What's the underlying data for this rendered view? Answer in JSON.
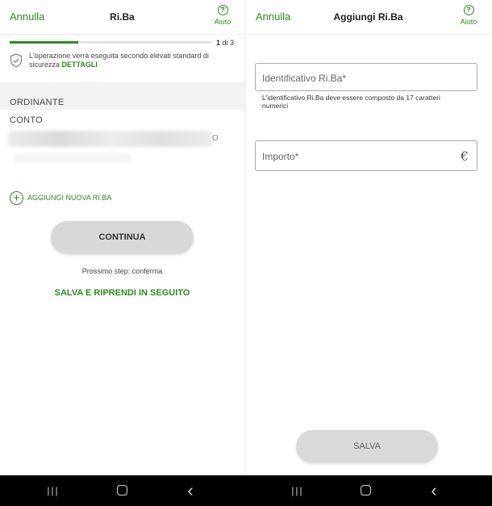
{
  "left": {
    "header": {
      "cancel": "Annulla",
      "title": "Ri.Ba",
      "help_label": "Aiuto",
      "help_glyph": "?"
    },
    "progress": {
      "value": 0.34,
      "step_current": "1",
      "step_rest": " di 3"
    },
    "security": {
      "text": "L'operazione verrà eseguita secondo elevati standard di sicurezza ",
      "link": "DETTAGLI"
    },
    "section_label": "ORDINANTE",
    "account_label": "CONTO",
    "account_tail": "O",
    "add_riba": {
      "icon": "plus-circle-icon",
      "glyph": "+",
      "label": "AGGIUNGI NUOVA RI.BA"
    },
    "continue_button": "CONTINUA",
    "next_step": "Prossimo step: conferma",
    "save_later": "SALVA E RIPRENDI IN SEGUITO"
  },
  "right": {
    "header": {
      "cancel": "Annulla",
      "title": "Aggiungi Ri.Ba",
      "help_label": "Aiuto",
      "help_glyph": "?"
    },
    "identifier_field": {
      "placeholder": "Identificativo Ri.Ba*",
      "value": ""
    },
    "identifier_hint": "L'identificativo Ri.Ba deve essere composto da 17 caratteri numerici",
    "amount_field": {
      "placeholder": "Importo*",
      "value": ""
    },
    "currency_symbol": "€",
    "save_button": "SALVA"
  },
  "navbar": {
    "recent_glyph": "|||",
    "back_glyph": "‹"
  },
  "colors": {
    "accent": "#2f8a1f",
    "button_grey": "#d8d8d8",
    "navbar": "#000000"
  }
}
